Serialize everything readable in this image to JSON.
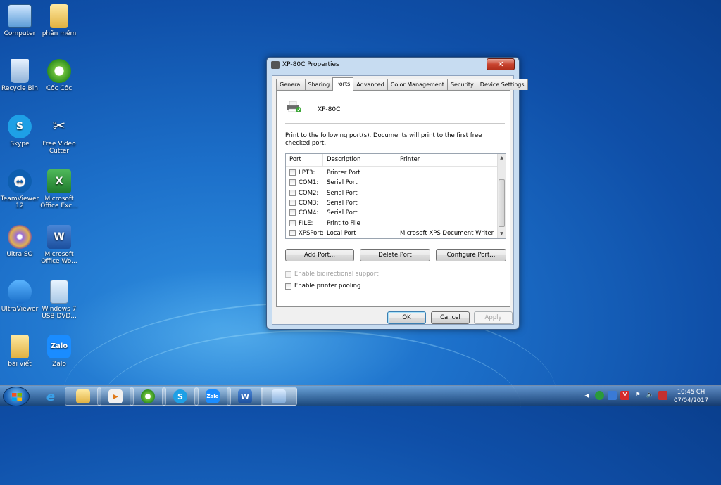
{
  "desktop": {
    "icons": [
      {
        "label": "Computer"
      },
      {
        "label": "phần mềm"
      },
      {
        "label": "Recycle Bin"
      },
      {
        "label": "Cốc Cốc"
      },
      {
        "label": "Skype"
      },
      {
        "label": "Free Video Cutter"
      },
      {
        "label": "TeamViewer 12"
      },
      {
        "label": "Microsoft Office Exc..."
      },
      {
        "label": "UltraISO"
      },
      {
        "label": "Microsoft Office Wo..."
      },
      {
        "label": "UltraViewer"
      },
      {
        "label": "Windows 7 USB DVD..."
      },
      {
        "label": "bài viết"
      },
      {
        "label": "Zalo"
      }
    ]
  },
  "dialog": {
    "title": "XP-80C Properties",
    "close_label": "✕",
    "tabs": [
      {
        "label": "General"
      },
      {
        "label": "Sharing"
      },
      {
        "label": "Ports"
      },
      {
        "label": "Advanced"
      },
      {
        "label": "Color Management"
      },
      {
        "label": "Security"
      },
      {
        "label": "Device Settings"
      }
    ],
    "active_tab": "Ports",
    "printer_name": "XP-80C",
    "instruction": "Print to the following port(s). Documents will print to the first free checked port.",
    "columns": {
      "port": "Port",
      "description": "Description",
      "printer": "Printer"
    },
    "ports": [
      {
        "port": "LPT3:",
        "description": "Printer Port",
        "printer": ""
      },
      {
        "port": "COM1:",
        "description": "Serial Port",
        "printer": ""
      },
      {
        "port": "COM2:",
        "description": "Serial Port",
        "printer": ""
      },
      {
        "port": "COM3:",
        "description": "Serial Port",
        "printer": ""
      },
      {
        "port": "COM4:",
        "description": "Serial Port",
        "printer": ""
      },
      {
        "port": "FILE:",
        "description": "Print to File",
        "printer": ""
      },
      {
        "port": "XPSPort:",
        "description": "Local Port",
        "printer": "Microsoft XPS Document Writer"
      }
    ],
    "buttons": {
      "add_port": "Add Port...",
      "delete_port": "Delete Port",
      "configure_port": "Configure Port...",
      "ok": "OK",
      "cancel": "Cancel",
      "apply": "Apply"
    },
    "options": {
      "bidirectional": "Enable bidirectional support",
      "pooling": "Enable printer pooling"
    }
  },
  "taskbar": {
    "clock_time": "10:45 CH",
    "clock_date": "07/04/2017",
    "zalo_label": "Zalo",
    "word_label": "W",
    "skype_label": "S",
    "tray_v_label": "V"
  }
}
